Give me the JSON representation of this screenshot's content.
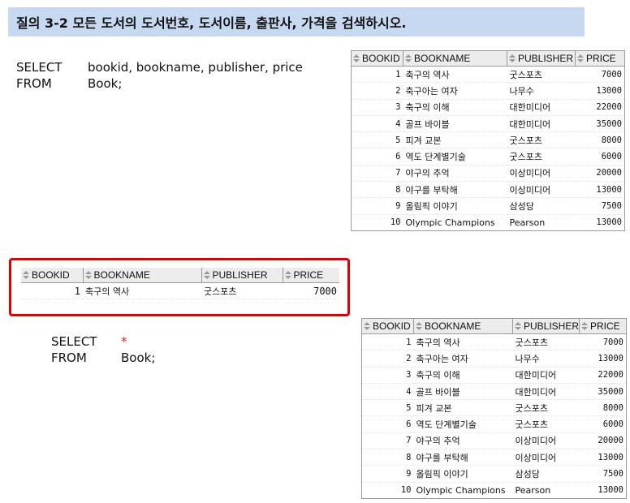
{
  "title": "질의 3-2   모든 도서의 도서번호,  도서이름, 출판사, 가격을 검색하시오.",
  "query1": {
    "select_kw": "SELECT",
    "select_cols": "bookid, bookname, publisher, price",
    "from_kw": "FROM",
    "from_table": "Book;"
  },
  "query2": {
    "select_kw": "SELECT",
    "select_cols": "*",
    "from_kw": "FROM",
    "from_table": "Book;"
  },
  "columns": [
    "BOOKID",
    "BOOKNAME",
    "PUBLISHER",
    "PRICE"
  ],
  "rows": [
    [
      "1",
      "축구의 역사",
      "굿스포츠",
      "7000"
    ],
    [
      "2",
      "축구아는 여자",
      "나무수",
      "13000"
    ],
    [
      "3",
      "축구의 이해",
      "대한미디어",
      "22000"
    ],
    [
      "4",
      "골프 바이블",
      "대한미디어",
      "35000"
    ],
    [
      "5",
      "피겨 교본",
      "굿스포츠",
      "8000"
    ],
    [
      "6",
      "역도 단계별기술",
      "굿스포츠",
      "6000"
    ],
    [
      "7",
      "야구의 추억",
      "이상미디어",
      "20000"
    ],
    [
      "8",
      "야구를 부탁해",
      "이상미디어",
      "13000"
    ],
    [
      "9",
      "올림픽 이야기",
      "삼성당",
      "7500"
    ],
    [
      "10",
      "Olympic Champions",
      "Pearson",
      "13000"
    ]
  ],
  "highlight_row": [
    "1",
    "축구의 역사",
    "굿스포츠",
    "7000"
  ],
  "colors": {
    "title_bg": "#c6d9f1",
    "highlight_border": "#e00000",
    "star": "#e02020"
  }
}
